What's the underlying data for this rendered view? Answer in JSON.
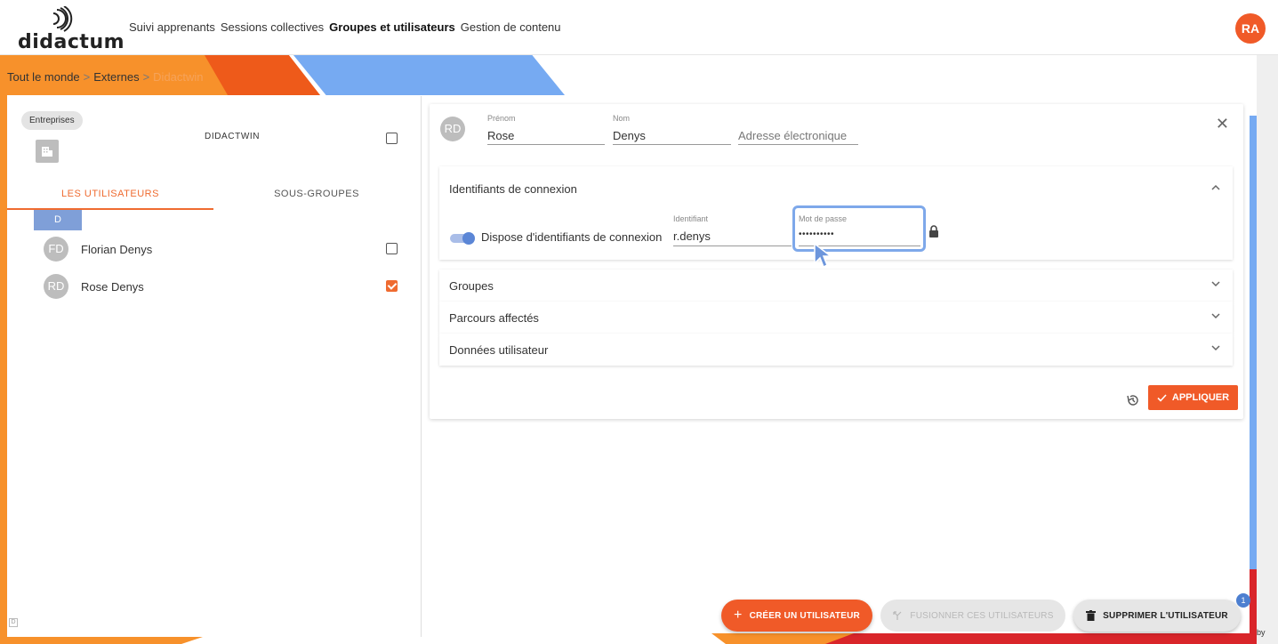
{
  "header": {
    "logo_text": "didactum",
    "nav": [
      "Suivi apprenants",
      "Sessions collectives",
      "Groupes et utilisateurs",
      "Gestion de contenu"
    ],
    "active_nav": "Groupes et utilisateurs",
    "user_initials": "RA"
  },
  "breadcrumb": {
    "items": [
      "Tout le monde",
      "Externes",
      "Didactwin"
    ],
    "separator": ">"
  },
  "left_panel": {
    "chip_label": "Entreprises",
    "group_name": "DIDACTWIN",
    "tabs": [
      "LES UTILISATEURS",
      "SOUS-GROUPES"
    ],
    "letter_header": "D",
    "users": [
      {
        "initials": "FD",
        "name": "Florian Denys",
        "checked": false
      },
      {
        "initials": "RD",
        "name": "Rose Denys",
        "checked": true
      }
    ],
    "footer_icon_letter": "D"
  },
  "detail": {
    "avatar_initials": "RD",
    "first_name_label": "Prénom",
    "first_name": "Rose",
    "last_name_label": "Nom",
    "last_name": "Denys",
    "email_placeholder": "Adresse électronique",
    "login_section": {
      "title": "Identifiants de connexion",
      "toggle_label": "Dispose d'identifiants de connexion",
      "toggle_on": true,
      "identifier_label": "Identifiant",
      "identifier": "r.denys",
      "password_label": "Mot de passe",
      "password_mask": "••••••••••"
    },
    "sections": [
      "Groupes",
      "Parcours affectés",
      "Données utilisateur"
    ],
    "apply_label": "APPLIQUER"
  },
  "actions": {
    "create_label": "CRÉER UN UTILISATEUR",
    "merge_label": "FUSIONNER CES UTILISATEURS",
    "delete_label": "SUPPRIMER L'UTILISATEUR",
    "badge_count": "1"
  },
  "footer": {
    "by_label": "by"
  },
  "colors": {
    "accent_orange": "#f05a28",
    "band_orange": "#f7912b",
    "band_blue": "#76aaf2",
    "focus_blue": "#7ea8ea",
    "badge_blue": "#4d7fd0"
  }
}
